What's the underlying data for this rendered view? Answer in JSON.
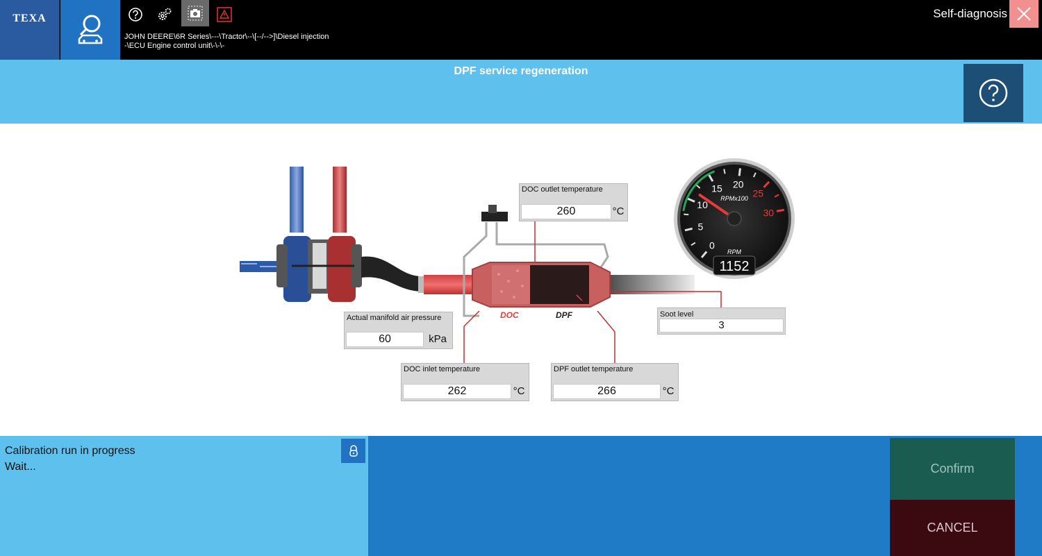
{
  "header": {
    "brand": "TEXA",
    "path_line1": "JOHN DEERE\\6R Series\\---\\Tractor\\--\\[--/-->]\\Diesel injection",
    "path_line2": "-\\ECU Engine control unit\\-\\-\\-",
    "mode": "Self-diagnosis",
    "tools": [
      "help-circle-icon",
      "settings-gears-icon",
      "camera-icon",
      "warning-icon"
    ]
  },
  "page": {
    "title": "DPF service regeneration"
  },
  "readouts": {
    "doc_outlet": {
      "label": "DOC outlet temperature",
      "value": "260",
      "unit": "°C"
    },
    "manifold": {
      "label": "Actual manifold air pressure",
      "value": "60",
      "unit": "kPa"
    },
    "doc_inlet": {
      "label": "DOC inlet temperature",
      "value": "262",
      "unit": "°C"
    },
    "dpf_outlet": {
      "label": "DPF outlet temperature",
      "value": "266",
      "unit": "°C"
    },
    "soot": {
      "label": "Soot level",
      "value": "3"
    }
  },
  "diagram": {
    "doc_label": "DOC",
    "dpf_label": "DPF"
  },
  "gauge": {
    "ticks": [
      "0",
      "5",
      "10",
      "15",
      "20",
      "25",
      "30"
    ],
    "scale_label": "RPMx100",
    "unit_label": "RPM",
    "value": "1152",
    "max": 3000,
    "colors": {
      "green": "#1ea85a",
      "red": "#e83a3a"
    }
  },
  "status": {
    "line1": "Calibration run in progress",
    "line2": "Wait..."
  },
  "buttons": {
    "confirm": "Confirm",
    "cancel": "CANCEL"
  },
  "colors": {
    "topbar": "#000000",
    "accent_light": "#5ec0ec",
    "accent": "#1f7bc6",
    "confirm": "#1b5c51",
    "cancel": "#3a0a10"
  }
}
